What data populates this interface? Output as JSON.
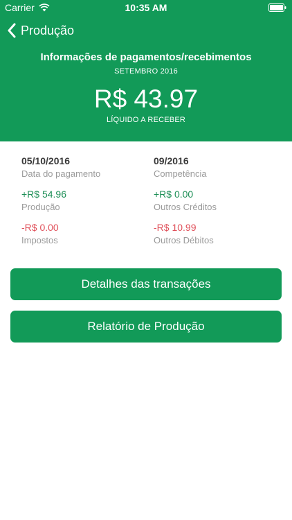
{
  "status_bar": {
    "carrier": "Carrier",
    "time": "10:35 AM"
  },
  "nav": {
    "back_label": "Produção"
  },
  "summary": {
    "title": "Informações de pagamentos/recebimentos",
    "month": "SETEMBRO 2016",
    "amount": "R$ 43.97",
    "caption": "LÍQUIDO A RECEBER"
  },
  "details": {
    "left": [
      {
        "value": "05/10/2016",
        "label": "Data do pagamento"
      },
      {
        "value": "+R$ 54.96",
        "label": "Produção"
      },
      {
        "value": "-R$ 0.00",
        "label": "Impostos"
      }
    ],
    "right": [
      {
        "value": "09/2016",
        "label": "Competência"
      },
      {
        "value": "+R$ 0.00",
        "label": "Outros Créditos"
      },
      {
        "value": "-R$ 10.99",
        "label": "Outros Débitos"
      }
    ]
  },
  "actions": {
    "details_label": "Detalhes das transações",
    "report_label": "Relatório de Produção"
  },
  "colors": {
    "brand_green": "#129a58",
    "positive": "#1e8f57",
    "negative": "#e0505a"
  },
  "icons": [
    "wifi-icon",
    "battery-icon",
    "chevron-left-icon"
  ]
}
